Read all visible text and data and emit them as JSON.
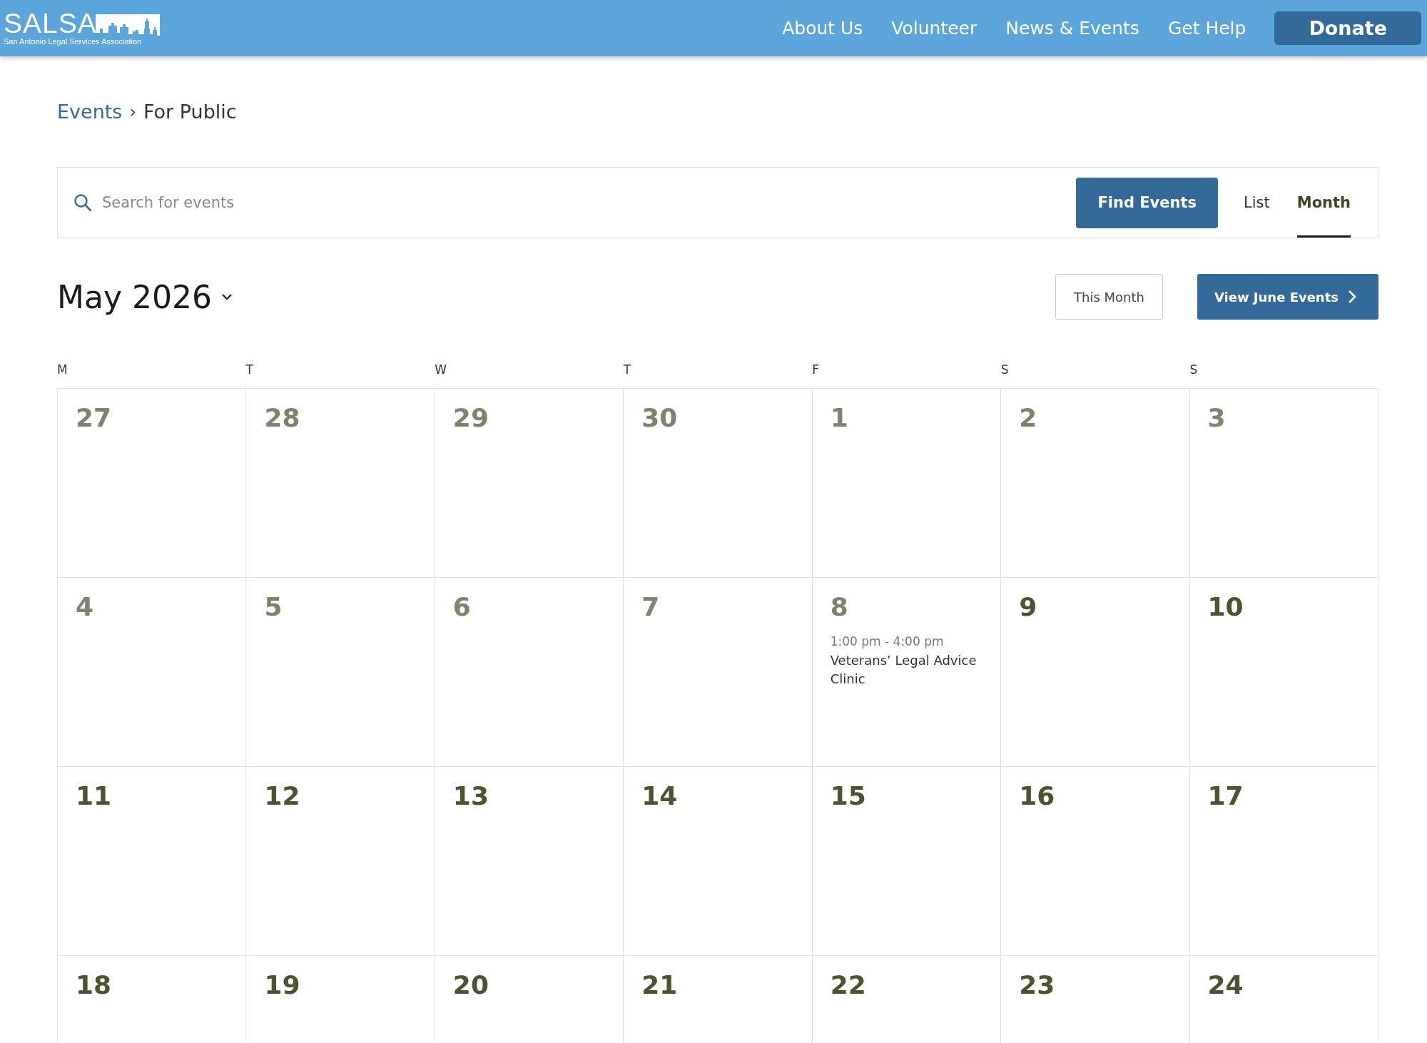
{
  "header": {
    "logo": {
      "name": "SALSA",
      "tagline": "San Antonio Legal Services Association"
    },
    "nav": [
      {
        "label": "About Us",
        "kind": "link"
      },
      {
        "label": "Volunteer",
        "kind": "link"
      },
      {
        "label": "News & Events",
        "kind": "link"
      },
      {
        "label": "Get Help",
        "kind": "link"
      },
      {
        "label": "Donate",
        "kind": "button"
      }
    ]
  },
  "breadcrumb": {
    "parent": "Events",
    "separator": "›",
    "current": "For Public"
  },
  "search": {
    "placeholder": "Search for events",
    "button": "Find Events"
  },
  "views": [
    {
      "label": "List",
      "selected": false
    },
    {
      "label": "Month",
      "selected": true
    }
  ],
  "month": {
    "title": "May 2026",
    "today_button": "This Month",
    "next_button": "View June Events"
  },
  "weekdays": [
    "M",
    "T",
    "W",
    "T",
    "F",
    "S",
    "S"
  ],
  "weeks": [
    [
      {
        "number": "27",
        "past": true
      },
      {
        "number": "28",
        "past": true
      },
      {
        "number": "29",
        "past": true
      },
      {
        "number": "30",
        "past": true
      },
      {
        "number": "1",
        "past": true
      },
      {
        "number": "2",
        "past": true
      },
      {
        "number": "3",
        "past": true
      }
    ],
    [
      {
        "number": "4",
        "past": true
      },
      {
        "number": "5",
        "past": true
      },
      {
        "number": "6",
        "past": true
      },
      {
        "number": "7",
        "past": true
      },
      {
        "number": "8",
        "past": true,
        "events": [
          {
            "time": "1:00 pm - 4:00 pm",
            "title": "Veterans’ Legal Advice Clinic"
          }
        ]
      },
      {
        "number": "9",
        "past": false
      },
      {
        "number": "10",
        "past": false
      }
    ],
    [
      {
        "number": "11",
        "past": false
      },
      {
        "number": "12",
        "past": false
      },
      {
        "number": "13",
        "past": false
      },
      {
        "number": "14",
        "past": false
      },
      {
        "number": "15",
        "past": false
      },
      {
        "number": "16",
        "past": false
      },
      {
        "number": "17",
        "past": false
      }
    ],
    [
      {
        "number": "18",
        "past": false
      },
      {
        "number": "19",
        "past": false
      },
      {
        "number": "20",
        "past": false
      },
      {
        "number": "21",
        "past": false
      },
      {
        "number": "22",
        "past": false
      },
      {
        "number": "23",
        "past": false
      },
      {
        "number": "24",
        "past": false
      }
    ]
  ]
}
